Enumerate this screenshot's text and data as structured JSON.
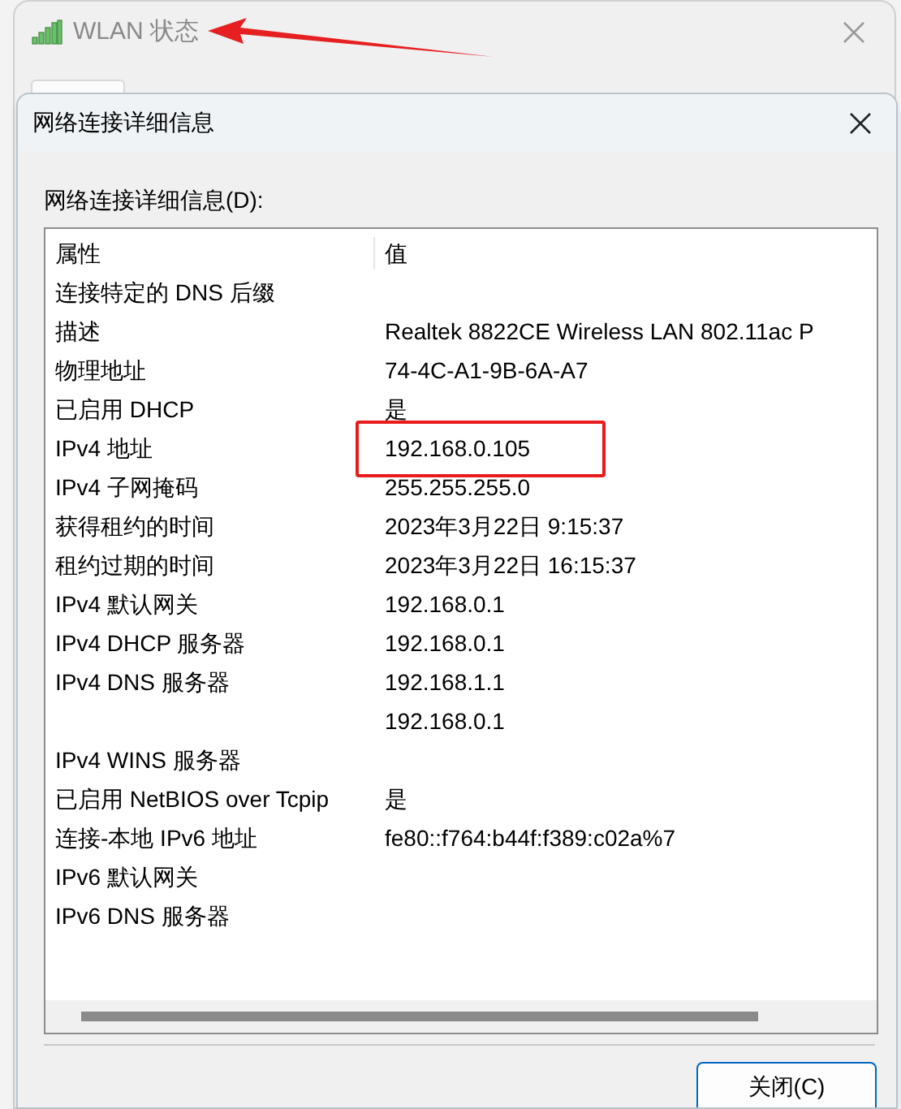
{
  "back_window": {
    "title": "WLAN 状态"
  },
  "dialog": {
    "title": "网络连接详细信息",
    "list_label": "网络连接详细信息(D):",
    "columns": [
      "属性",
      "值"
    ],
    "rows": [
      {
        "property": "连接特定的 DNS 后缀"
      },
      {
        "property": "描述",
        "value": "Realtek 8822CE Wireless LAN 802.11ac P"
      },
      {
        "property": "物理地址",
        "value": "74-4C-A1-9B-6A-A7"
      },
      {
        "property": "已启用 DHCP",
        "value": "是"
      },
      {
        "property": "IPv4 地址",
        "value": "192.168.0.105"
      },
      {
        "property": "IPv4 子网掩码",
        "value": "255.255.255.0"
      },
      {
        "property": "获得租约的时间",
        "value": "2023年3月22日 9:15:37"
      },
      {
        "property": "租约过期的时间",
        "value": "2023年3月22日 16:15:37"
      },
      {
        "property": "IPv4 默认网关",
        "value": "192.168.0.1"
      },
      {
        "property": "IPv4 DHCP 服务器",
        "value": "192.168.0.1"
      },
      {
        "property": "IPv4 DNS 服务器",
        "value": "192.168.1.1"
      },
      {
        "value": "192.168.0.1"
      },
      {
        "property": "IPv4 WINS 服务器"
      },
      {
        "property": "已启用 NetBIOS over Tcpip",
        "value": "是"
      },
      {
        "property": "连接-本地 IPv6 地址",
        "value": "fe80::f764:b44f:f389:c02a%7"
      },
      {
        "property": "IPv6 默认网关"
      },
      {
        "property": "IPv6 DNS 服务器"
      }
    ],
    "close_button": "关闭(C)"
  }
}
